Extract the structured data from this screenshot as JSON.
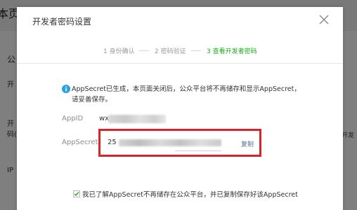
{
  "background": {
    "title_fragment": "本页",
    "section_fragment": "公",
    "left_fragments": [
      "开",
      "开",
      "码(",
      "IP"
    ],
    "right_fragment": "开发"
  },
  "modal": {
    "title": "开发者密码设置",
    "close_icon": "close-icon",
    "steps": [
      {
        "label": "1 身份确认",
        "active": false
      },
      {
        "label": "2 密码验证",
        "active": false
      },
      {
        "label": "3 查看开发者密码",
        "active": true
      }
    ],
    "notice": "AppSecret已生成，本页面关闭后，公众平台将不再储存和显示AppSecret，请妥善保存。",
    "appid": {
      "label": "AppID",
      "value_prefix": "wx"
    },
    "appsecret": {
      "label": "AppSecret",
      "value_prefix": "25",
      "copy_label": "复制"
    },
    "confirm_text": "我已了解AppSecret不再储存在公众平台，并已复制保存好该AppSecret"
  },
  "colors": {
    "accent_green": "#1aad19",
    "highlight_red": "#d9222a",
    "link_blue": "#576b95",
    "info_blue": "#2aa2e6"
  }
}
